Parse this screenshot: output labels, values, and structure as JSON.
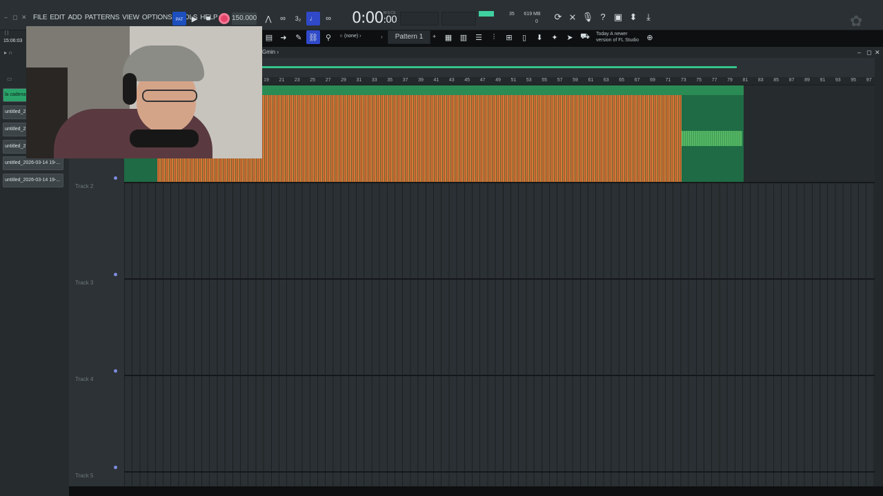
{
  "menu": [
    "FILE",
    "EDIT",
    "ADD",
    "PATTERNS",
    "VIEW",
    "OPTIONS",
    "TOOLS",
    "HELP"
  ],
  "transport": {
    "mode": "PAT",
    "tempo": "150.000",
    "time_main": "0:00",
    "time_sub": "00",
    "time_units": "M:S:CS"
  },
  "monitor": {
    "cpu": "35",
    "ram": "619 MB",
    "polyphony": "0"
  },
  "toolbar2": {
    "snap": "(none)",
    "pattern": "Pattern 1"
  },
  "hint": {
    "line1": "Today  A newer",
    "line2": "version of FL Studio"
  },
  "clock": "15:06:03",
  "playlist_title": "Gmin",
  "picker": [
    {
      "label": "la cadena",
      "active": true
    },
    {
      "label": "untitled_2",
      "active": false
    },
    {
      "label": "untitled_2",
      "active": false
    },
    {
      "label": "untitled_2",
      "active": false
    },
    {
      "label": "untitled_2026-03-14 19-...",
      "active": false
    },
    {
      "label": "untitled_2026-03-14 19-...",
      "active": false
    }
  ],
  "ruler": [
    "19",
    "21",
    "23",
    "25",
    "27",
    "29",
    "31",
    "33",
    "35",
    "37",
    "39",
    "41",
    "43",
    "45",
    "47",
    "49",
    "51",
    "53",
    "55",
    "57",
    "59",
    "61",
    "63",
    "65",
    "67",
    "69",
    "71",
    "73",
    "75",
    "77",
    "79",
    "81",
    "83",
    "85",
    "87",
    "89",
    "91",
    "93",
    "95",
    "97"
  ],
  "tracks": [
    "Track 2",
    "Track 3",
    "Track 4",
    "Track 5"
  ],
  "colors": {
    "accent": "#34c48a",
    "clip": "#2b8b55",
    "wave": "#c76b34",
    "record": "#e6446a"
  },
  "icons": [
    "record-icon",
    "play-icon",
    "stop-icon",
    "metronome-icon",
    "mixer-icon",
    "piano-roll-icon",
    "browser-icon",
    "help-icon",
    "download-icon",
    "globe-icon"
  ]
}
